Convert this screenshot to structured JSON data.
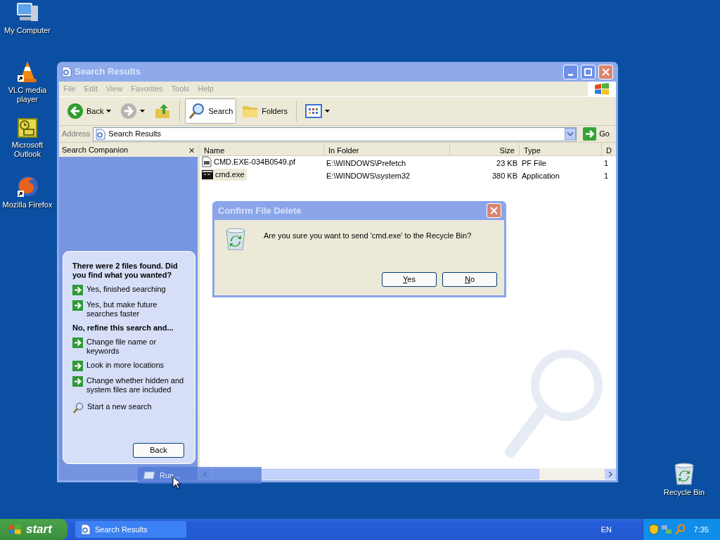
{
  "desktop_icons": [
    {
      "label": "My Computer",
      "kind": "computer"
    },
    {
      "label": "VLC media player",
      "kind": "vlc"
    },
    {
      "label": "Microsoft Outlook",
      "kind": "outlook"
    },
    {
      "label": "Mozilla Firefox",
      "kind": "firefox"
    },
    {
      "label": "Recycle Bin",
      "kind": "recycle"
    }
  ],
  "window": {
    "title": "Search Results",
    "menu": [
      "File",
      "Edit",
      "View",
      "Favorites",
      "Tools",
      "Help"
    ],
    "toolbar": [
      {
        "label": "Back",
        "kind": "back",
        "selected": false
      },
      {
        "kind": "forward",
        "selected": false
      },
      {
        "kind": "up",
        "selected": false
      },
      {
        "label": "Search",
        "kind": "search",
        "selected": true
      },
      {
        "label": "Folders",
        "kind": "folders",
        "selected": false
      },
      {
        "kind": "views",
        "selected": false
      }
    ],
    "address": {
      "label": "Address",
      "value": "Search Results",
      "go": "Go"
    },
    "companion": {
      "title": "Search Companion",
      "close": "×",
      "heading": "There were 2 files found. Did you find what you wanted?",
      "options": [
        "Yes, finished searching",
        "Yes, but make future searches faster"
      ],
      "refine_heading": "No, refine this search and...",
      "refine_options": [
        "Change file name or keywords",
        "Look in more locations",
        "Change whether hidden and system files are included"
      ],
      "new_search": "Start a new search",
      "back": "Back"
    },
    "columns": [
      "Name",
      "In Folder",
      "Size",
      "Type",
      "D"
    ],
    "rows": [
      {
        "name": "CMD.EXE-034B0549.pf",
        "folder": "E:\\WINDOWS\\Prefetch",
        "size": "23 KB",
        "type": "PF File",
        "column_5": "1",
        "kind": "pf",
        "selected": false
      },
      {
        "name": "cmd.exe",
        "folder": "E:\\WINDOWS\\system32",
        "size": "380 KB",
        "type": "Application",
        "column_5": "1",
        "kind": "app",
        "selected": true
      }
    ]
  },
  "dialog": {
    "title": "Confirm File Delete",
    "message": "Are you sure you want to send 'cmd.exe' to the Recycle Bin?",
    "buttons": [
      "Yes",
      "No"
    ]
  },
  "drag_preview": {
    "label": "Run..."
  },
  "taskbar": {
    "start": "start",
    "tasks": [
      {
        "label": "Search Results",
        "selected": false
      }
    ],
    "language": "EN",
    "clock": "7:35"
  }
}
